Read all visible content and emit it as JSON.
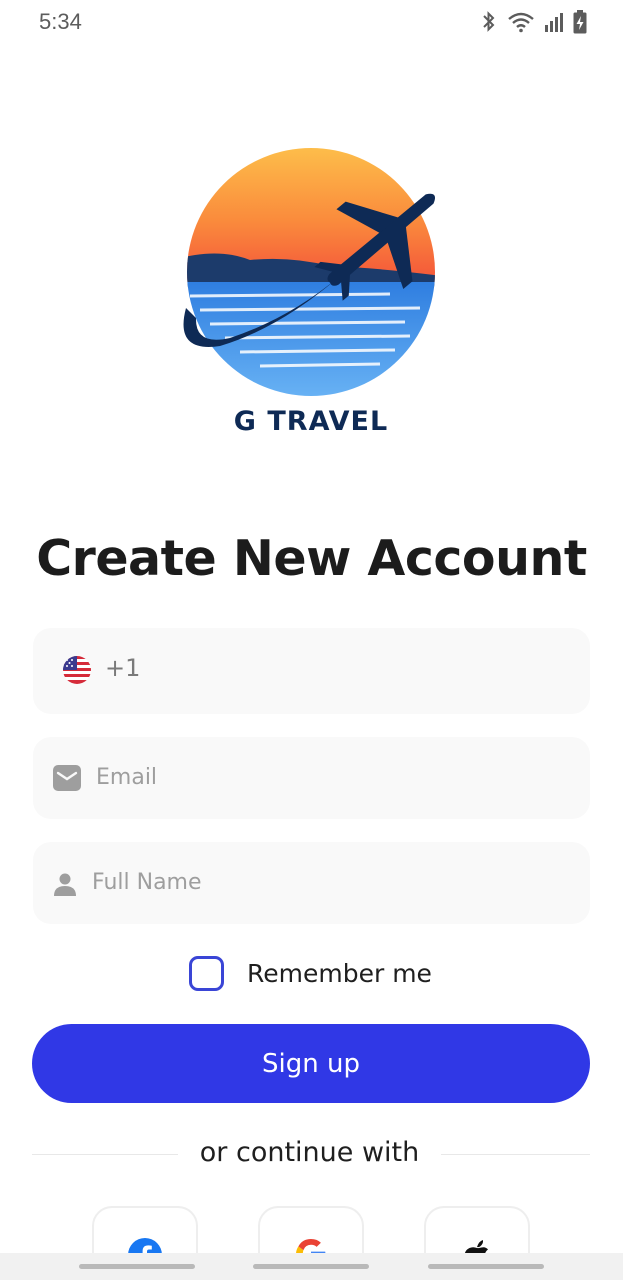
{
  "status_bar": {
    "time": "5:34",
    "icons": [
      "bluetooth-icon",
      "wifi-icon",
      "signal-icon",
      "battery-charging-icon"
    ]
  },
  "logo": {
    "brand_text": "G TRAVEL",
    "colors": {
      "sun_top": "#fdbd4a",
      "sun_bottom": "#f4553a",
      "sea": "#3f8fe0",
      "plane": "#0e2a55"
    }
  },
  "title": "Create New Account",
  "form": {
    "phone": {
      "country_flag": "us-flag-icon",
      "dial_code": "+1",
      "value": ""
    },
    "email": {
      "placeholder": "Email",
      "icon": "mail-icon"
    },
    "full_name": {
      "placeholder": "Full Name",
      "icon": "person-icon"
    },
    "remember_label": "Remember me",
    "remember_checked": false
  },
  "signup_label": "Sign up",
  "divider_text": "or continue with",
  "social": [
    "facebook-icon",
    "google-icon",
    "apple-icon"
  ],
  "colors": {
    "accent": "#3038e6",
    "field_bg": "#f9f9f9"
  }
}
